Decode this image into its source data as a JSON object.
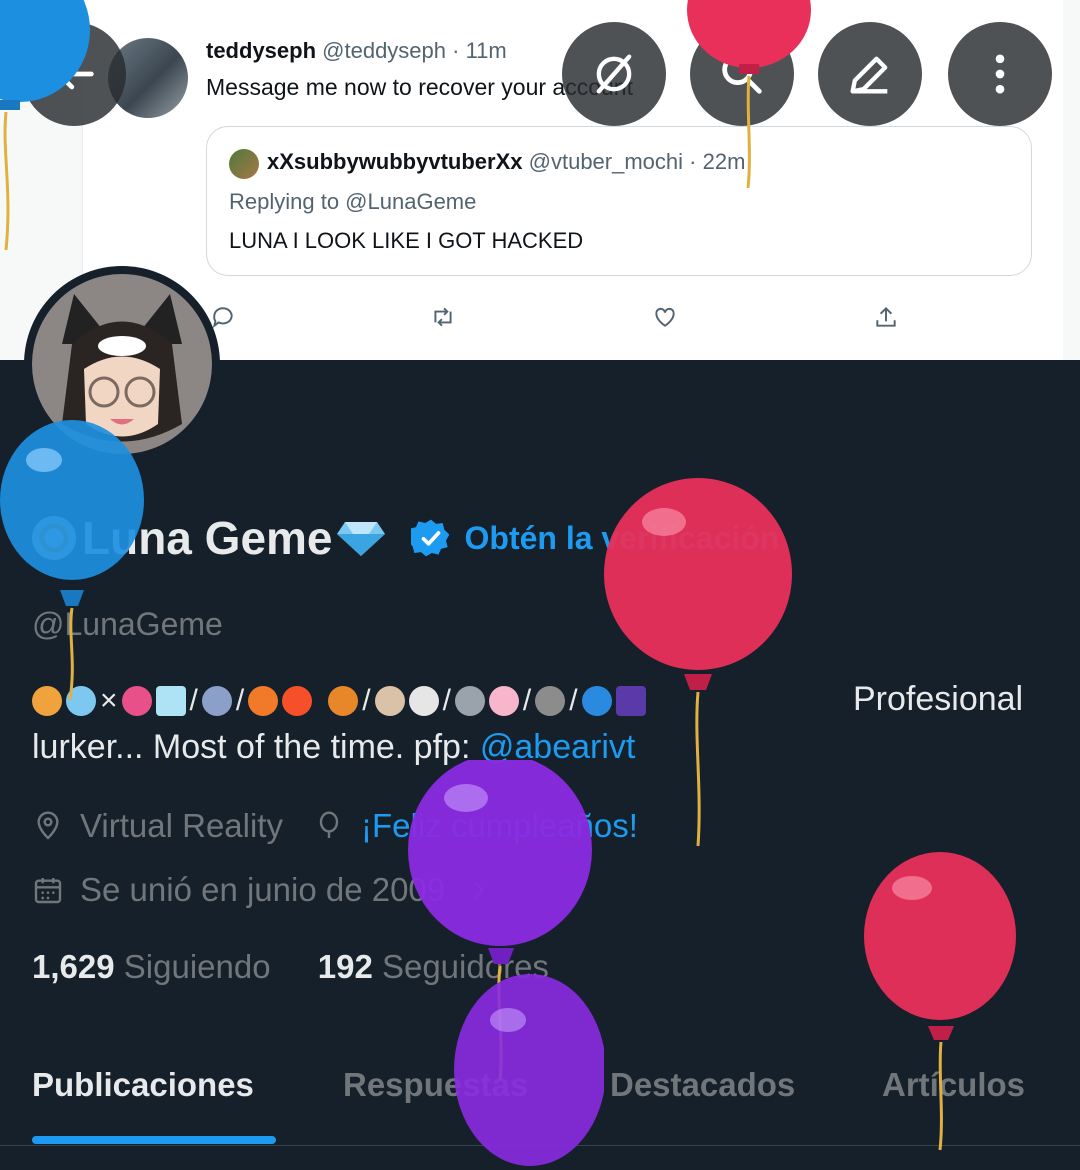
{
  "banner_tweet": {
    "author_name": "teddyseph",
    "author_handle": "@teddyseph",
    "time": "· 11m",
    "text": "Message me now to recover your account",
    "quoted": {
      "author_name": "xXsubbywubbyvtuberXx",
      "author_handle": "@vtuber_mochi",
      "time": "· 22m",
      "replying_to": "Replying to @LunaGeme",
      "text": "LUNA I LOOK LIKE I GOT HACKED"
    },
    "actions": [
      "reply-icon",
      "retweet-icon",
      "like-icon",
      "share-icon"
    ]
  },
  "top_bar": {
    "buttons": [
      "back-arrow-icon",
      "hide-eye-slash-icon",
      "search-icon",
      "edit-pencil-icon",
      "more-vertical-icon"
    ]
  },
  "profile": {
    "display_name": "Luna Geme",
    "verify_cta": "Obtén la verificación",
    "handle": "@LunaGeme",
    "bio_symbols": "×",
    "bio_text_1": "Profesional",
    "bio_text_2": "lurker... Most of the time. pfp:",
    "bio_link": "@abearivt",
    "location": "Virtual Reality",
    "birthday": "¡Feliz cumpleaños!",
    "joined": "Se unió en junio de 2009",
    "following_count": "1,629",
    "following_label": "Siguiendo",
    "followers_count": "192",
    "followers_label": "Seguidores"
  },
  "tabs": {
    "items": [
      "Publicaciones",
      "Respuestas",
      "Destacados",
      "Artículos"
    ],
    "active": "Publicaciones"
  },
  "colors": {
    "background": "#15202b",
    "accent": "#1d9bf0",
    "text_primary": "#e7e9ea",
    "text_secondary": "#71767b"
  }
}
